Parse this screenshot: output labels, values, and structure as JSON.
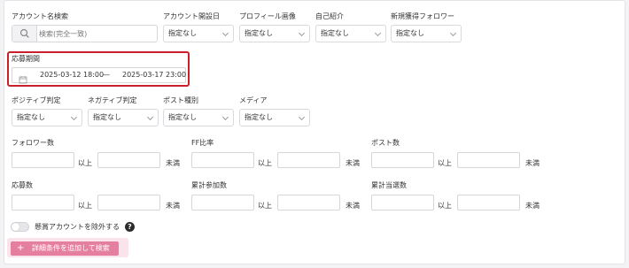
{
  "filters": {
    "account_search": {
      "label": "アカウント名検索",
      "placeholder": "検索(完全一致)"
    },
    "account_opened": {
      "label": "アカウント開設日",
      "value": "指定なし"
    },
    "profile_image": {
      "label": "プロフィール画像",
      "value": "指定なし"
    },
    "self_intro": {
      "label": "自己紹介",
      "value": "指定なし"
    },
    "new_followers": {
      "label": "新規獲得フォロワー",
      "value": "指定なし"
    },
    "period": {
      "label": "応募期間",
      "start": "2025-03-12 18:00",
      "separator": "—",
      "end": "2025-03-17 23:00"
    },
    "positive": {
      "label": "ポジティブ判定",
      "value": "指定なし"
    },
    "negative": {
      "label": "ネガティブ判定",
      "value": "指定なし"
    },
    "post_type": {
      "label": "ポスト種別",
      "value": "指定なし"
    },
    "media": {
      "label": "メディア",
      "value": "指定なし"
    }
  },
  "ranges": {
    "min_unit": "以上",
    "max_unit": "未満",
    "followers": "フォロワー数",
    "ff_ratio": "FF比率",
    "post_count": "ポスト数",
    "applications": "応募数",
    "total_participation": "累計参加数",
    "total_wins": "累計当選数"
  },
  "exclude_toggle": {
    "label": "懸賞アカウントを除外する",
    "help": "?"
  },
  "add_condition_button": {
    "icon": "+",
    "label": "詳細条件を追加して検索"
  },
  "colors": {
    "highlight": "#cc1f2e",
    "button": "#e57fa0",
    "button_glow": "#fbe3ec"
  }
}
